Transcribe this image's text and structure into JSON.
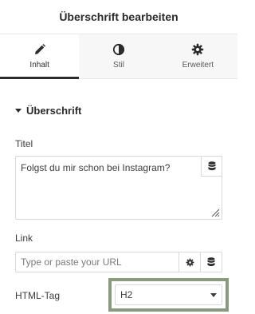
{
  "header": {
    "title": "Überschrift bearbeiten"
  },
  "tabs": [
    {
      "label": "Inhalt",
      "icon": "pencil-icon",
      "active": true
    },
    {
      "label": "Stil",
      "icon": "contrast-icon",
      "active": false
    },
    {
      "label": "Erweitert",
      "icon": "gear-icon",
      "active": false
    }
  ],
  "section": {
    "title": "Überschrift"
  },
  "titel": {
    "label": "Titel",
    "value": "Folgst du mir schon bei Instagram?",
    "dynamic_icon": "database-icon"
  },
  "link": {
    "label": "Link",
    "placeholder": "Type or paste your URL",
    "value": "",
    "options_icon": "gear-icon",
    "dynamic_icon": "database-icon"
  },
  "html_tag": {
    "label": "HTML-Tag",
    "selected": "H2"
  },
  "colors": {
    "accent": "#2b2b2b",
    "highlight_border": "#8a9a7f",
    "input_border": "#d5d8dc",
    "tab_background": "#f7f7f8"
  }
}
